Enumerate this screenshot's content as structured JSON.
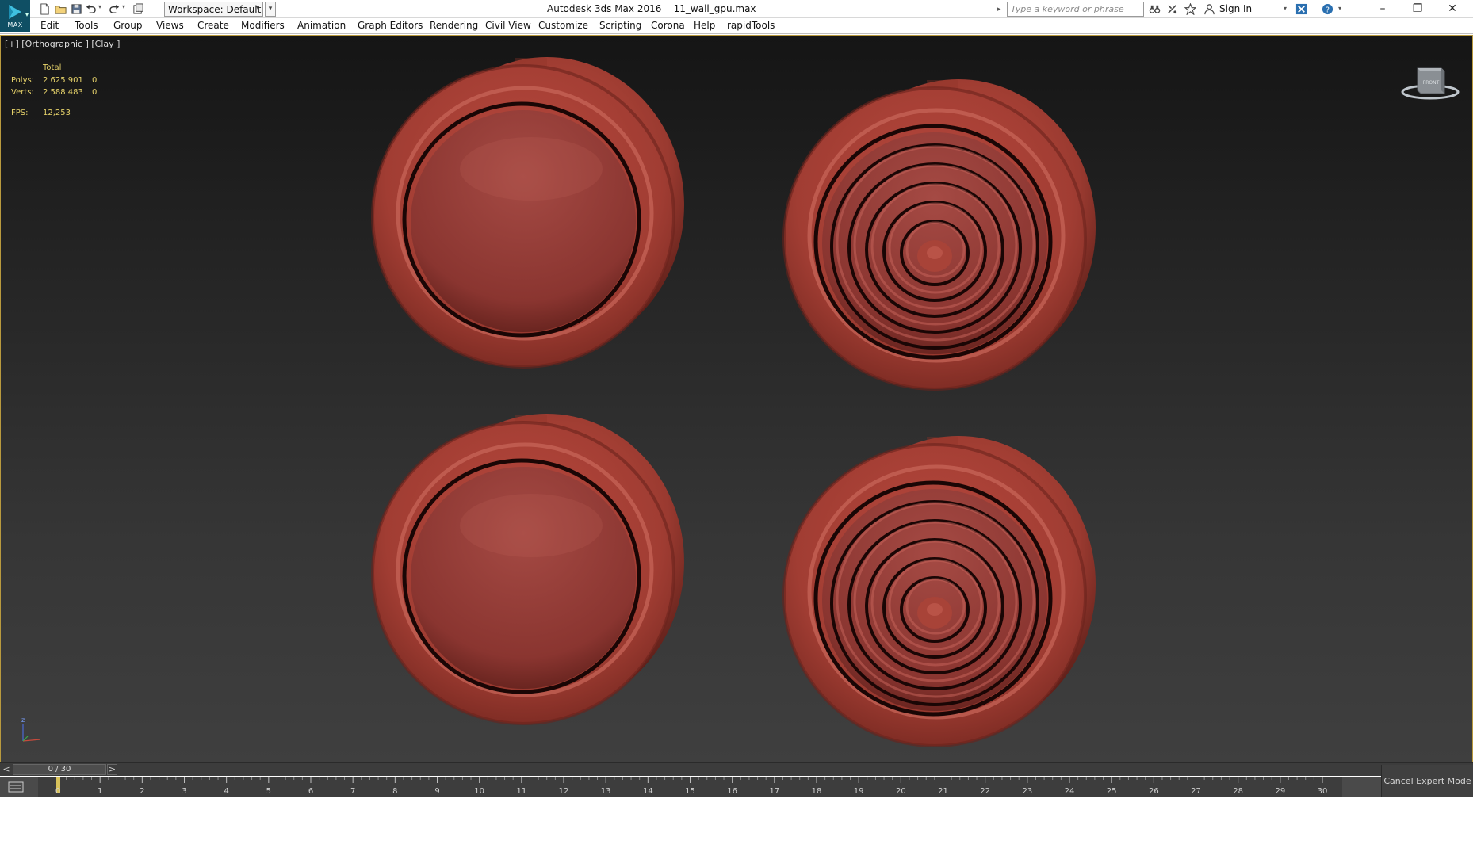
{
  "app": {
    "logo_sub": "MAX",
    "title": "Autodesk 3ds Max 2016",
    "filename": "11_wall_gpu.max"
  },
  "quick_access": {
    "icons": [
      "new-file-icon",
      "open-file-icon",
      "save-icon",
      "undo-icon",
      "redo-icon",
      "project-folder-icon"
    ],
    "workspace_label": "Workspace: Default"
  },
  "infocenter": {
    "search_placeholder": "Type a keyword or phrase",
    "signin_label": "Sign In",
    "icons": [
      "binoculars-icon",
      "subscription-icon",
      "favorites-star-icon",
      "user-icon",
      "exchange-x-icon",
      "help-icon"
    ]
  },
  "window_controls": {
    "minimize": "–",
    "restore": "❐",
    "close": "✕"
  },
  "menu": {
    "items": [
      {
        "label": "Edit"
      },
      {
        "label": "Tools"
      },
      {
        "label": "Group"
      },
      {
        "label": "Views"
      },
      {
        "label": "Create"
      },
      {
        "label": "Modifiers"
      },
      {
        "label": "Animation"
      },
      {
        "label": "Graph Editors"
      },
      {
        "label": "Rendering"
      },
      {
        "label": "Civil View"
      },
      {
        "label": "Customize"
      },
      {
        "label": "Scripting"
      },
      {
        "label": "Corona"
      },
      {
        "label": "Help"
      },
      {
        "label": "rapidTools"
      }
    ]
  },
  "viewport": {
    "label": "[+] [Orthographic ] [Clay ]",
    "stats": {
      "header": "Total",
      "polys_label": "Polys:",
      "polys_value": "2 625 901",
      "polys_sel": "0",
      "verts_label": "Verts:",
      "verts_value": "2 588 483",
      "verts_sel": "0",
      "fps_label": "FPS:",
      "fps_value": "12,253"
    },
    "viewcube_label": "FRONT",
    "axis_label": "z",
    "object_color": "#b5473b",
    "objects": [
      {
        "name": "button-plain",
        "rings": 0
      },
      {
        "name": "button-ringed",
        "rings": 5
      },
      {
        "name": "button-plain",
        "rings": 0
      },
      {
        "name": "button-ringed",
        "rings": 5
      }
    ]
  },
  "timeline": {
    "prev": "<",
    "next": ">",
    "frame_display": "0 / 30",
    "current_frame": 0,
    "start": 0,
    "end": 30
  },
  "cancel_expert_mode": "Cancel Expert Mode",
  "colors": {
    "accent_border": "#b99a3e",
    "stats_text": "#e6d26a",
    "logo_bg": "#0f4f64"
  }
}
